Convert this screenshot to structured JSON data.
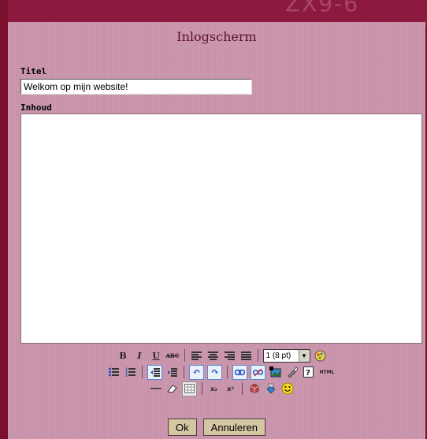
{
  "window": {
    "title": "Inlogscherm",
    "banner_text": "ZX9-6"
  },
  "form": {
    "title_label": "Titel",
    "title_value": "Welkom op mijn website!",
    "content_label": "Inhoud"
  },
  "toolbar": {
    "bold": "B",
    "italic": "I",
    "underline": "U",
    "strikethrough": "ABC",
    "font_size": "1 (8 pt)",
    "html": "HTML",
    "subscript": "x₂",
    "superscript": "x²"
  },
  "buttons": {
    "ok": "Ok",
    "cancel": "Annuleren"
  },
  "colors": {
    "background": "#7a0f2e",
    "panel": "#c893aa",
    "title_text": "#5a0f2a",
    "button_face": "#d4c6a0"
  }
}
